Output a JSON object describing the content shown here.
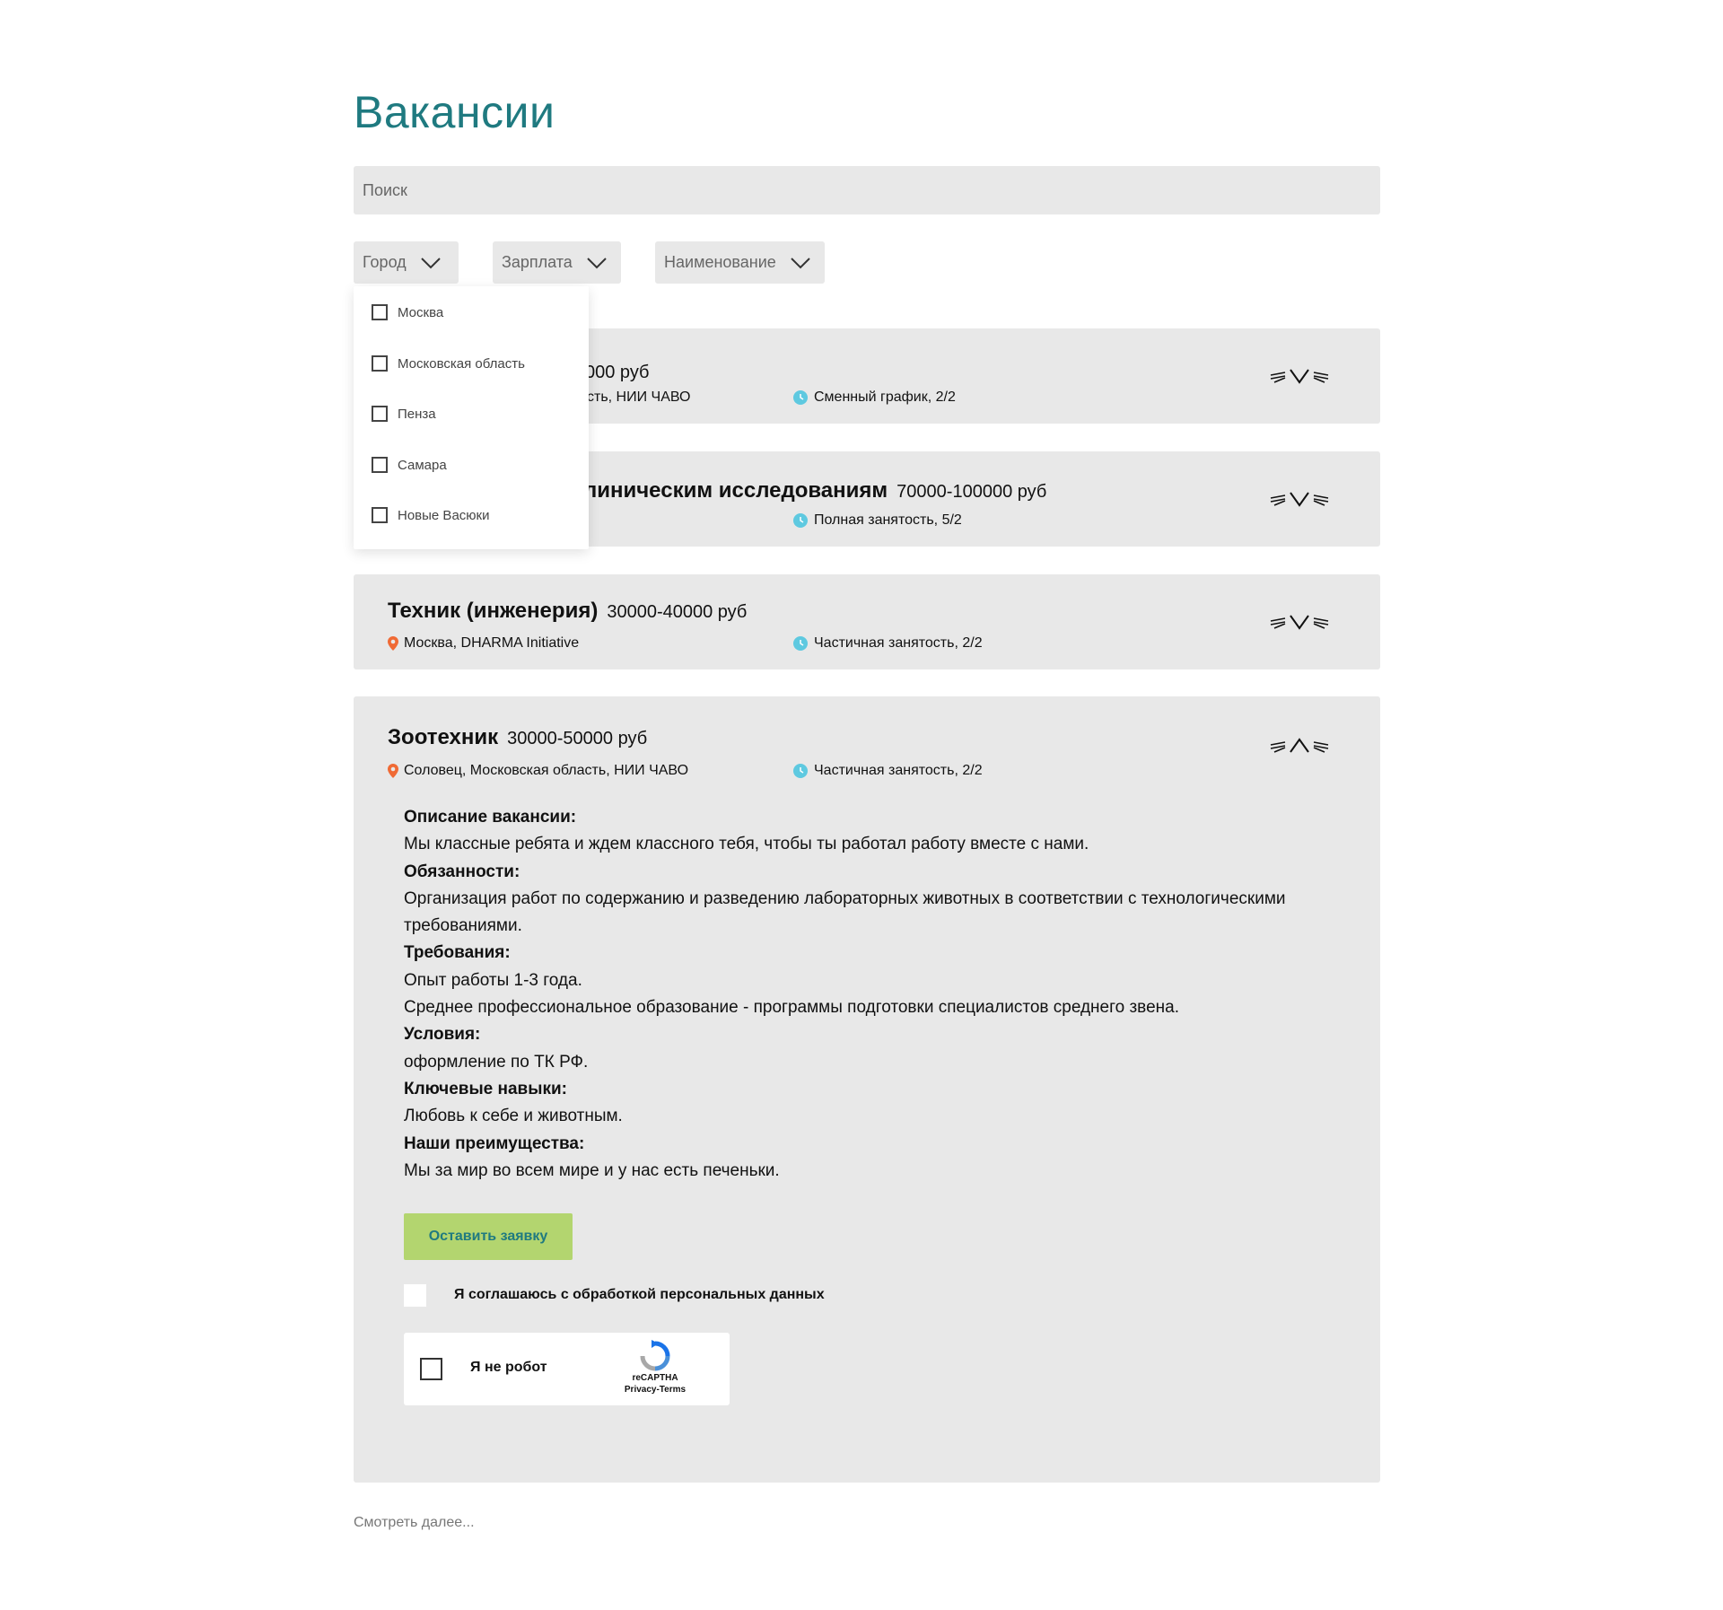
{
  "page": {
    "title": "Вакансии"
  },
  "search": {
    "placeholder": "Поиск"
  },
  "filters": {
    "city": "Город",
    "salary": "Зарплата",
    "name": "Наименование"
  },
  "city_dropdown": {
    "items": [
      "Москва",
      "Московская область",
      "Пенза",
      "Самара",
      "Новые Васюки"
    ]
  },
  "jobs": [
    {
      "title": "",
      "salary": "000 руб",
      "location": "сть, НИИ ЧАВО",
      "schedule": "Сменный график, 2/2",
      "expanded": false
    },
    {
      "title": "линическим исследованиям",
      "salary": "70000-100000 руб",
      "location": "",
      "schedule": "Полная занятость, 5/2",
      "expanded": false
    },
    {
      "title": "Техник (инженерия)",
      "salary": "30000-40000 руб",
      "location": "Москва, DHARMA Initiative",
      "schedule": "Частичная занятость, 2/2",
      "expanded": false
    },
    {
      "title": "Зоотехник",
      "salary": "30000-50000 руб",
      "location": "Соловец, Московская область, НИИ ЧАВО",
      "schedule": "Частичная занятость, 2/2",
      "expanded": true,
      "description": [
        {
          "heading": "Описание вакансии:",
          "lines": [
            "Мы классные ребята и ждем классного тебя, чтобы ты работал работу вместе с нами."
          ]
        },
        {
          "heading": "Обязанности:",
          "lines": [
            "Организация работ по содержанию и разведению лабораторных животных в соответствии с технологическими требованиями."
          ]
        },
        {
          "heading": "Требования:",
          "lines": [
            "Опыт работы 1-3 года.",
            "Среднее профессиональное образование - программы подготовки специалистов среднего звена."
          ]
        },
        {
          "heading": "Условия:",
          "lines": [
            "оформление по ТК РФ."
          ]
        },
        {
          "heading": "Ключевые навыки:",
          "lines": [
            "Любовь к себе и животным."
          ]
        },
        {
          "heading": "Наши преимущества:",
          "lines": [
            "Мы за мир во всем мире и у нас есть печеньки."
          ]
        }
      ],
      "apply_label": "Оставить заявку",
      "consent_label": "Я соглашаюсь с обработкой персональных данных",
      "captcha": {
        "label": "Я не робот",
        "brand": "reCAPTHA",
        "links": "Privacy-Terms"
      }
    }
  ],
  "more_link": "Смотреть далее...",
  "colors": {
    "title": "#1f7a80",
    "card_bg": "#e8e8e8",
    "apply_bg": "#b3d56f",
    "pin": "#f06a35",
    "clock": "#5ec9e0"
  }
}
